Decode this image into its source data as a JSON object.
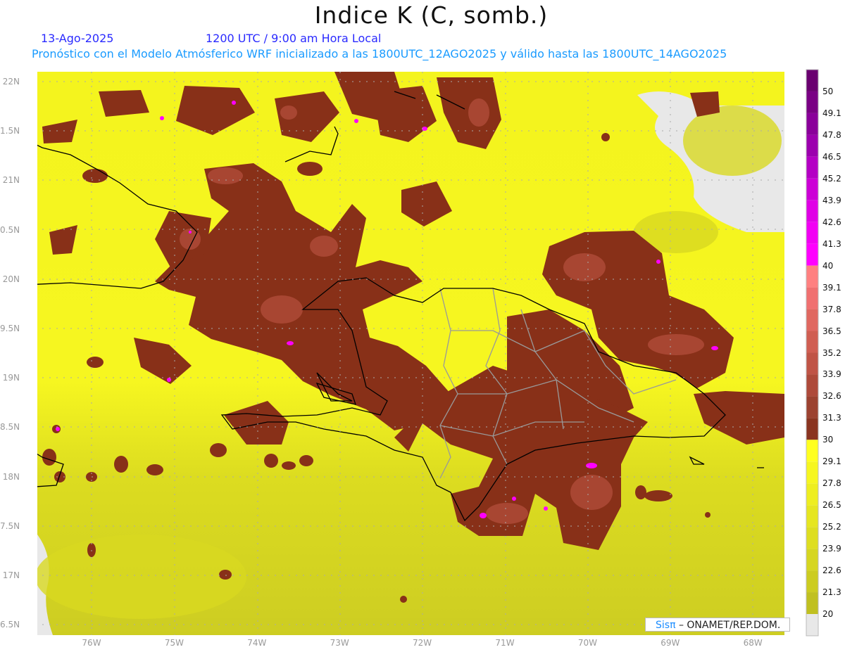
{
  "header": {
    "title": "Indice K (C, somb.)",
    "date": "13-Ago-2025",
    "time": "1200 UTC / 9:00 am Hora Local",
    "description": "Pronóstico con el Modelo Atmósferico WRF inicializado a las 1800UTC_12AGO2025 y válido hasta las  1800UTC_14AGO2025"
  },
  "axes": {
    "y_labels": [
      "22N",
      "1.5N",
      "21N",
      "0.5N",
      "20N",
      "9.5N",
      "19N",
      "8.5N",
      "18N",
      "7.5N",
      "17N",
      "6.5N"
    ],
    "x_labels": [
      "76W",
      "75W",
      "74W",
      "73W",
      "72W",
      "71W",
      "70W",
      "69W",
      "68W"
    ]
  },
  "legend": {
    "labels": [
      "50",
      "49.1",
      "47.8",
      "46.5",
      "45.2",
      "43.9",
      "42.6",
      "41.3",
      "40",
      "39.1",
      "37.8",
      "36.5",
      "35.2",
      "33.9",
      "32.6",
      "31.3",
      "30",
      "29.1",
      "27.8",
      "26.5",
      "25.2",
      "23.9",
      "22.6",
      "21.3",
      "20"
    ],
    "colors": [
      "#6a0070",
      "#7a0084",
      "#8a009a",
      "#9c00ae",
      "#b400c4",
      "#cc00d6",
      "#e000e6",
      "#f200f4",
      "#ff00ff",
      "#ff8080",
      "#f07070",
      "#e06860",
      "#d05e52",
      "#c05446",
      "#ae4a3a",
      "#9c4230",
      "#8a3420",
      "#ffff20",
      "#f6f620",
      "#eeee20",
      "#e6e620",
      "#dede20",
      "#d6d620",
      "#cccc20",
      "#c0c020",
      "#e8e8e8"
    ]
  },
  "credit": {
    "brand": "Sisπ",
    "org": "– ONAMET/REP.DOM."
  }
}
